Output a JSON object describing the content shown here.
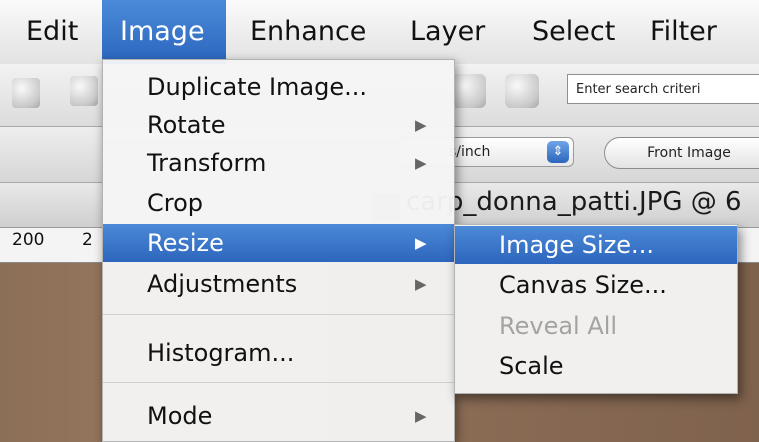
{
  "menubar": {
    "items": [
      {
        "label": "Edit"
      },
      {
        "label": "Image",
        "active": true
      },
      {
        "label": "Enhance"
      },
      {
        "label": "Layer"
      },
      {
        "label": "Select"
      },
      {
        "label": "Filter"
      }
    ]
  },
  "toolbar": {
    "search_placeholder": "Enter search criteri",
    "units_value": "s/inch",
    "front_image_label": "Front Image"
  },
  "document": {
    "title": "carp_donna_patti.JPG @ 6",
    "ruler_labels": [
      "200",
      "2"
    ]
  },
  "image_menu": {
    "items": [
      {
        "label": "Duplicate Image...",
        "has_submenu": false
      },
      {
        "label": "Rotate",
        "has_submenu": true
      },
      {
        "label": "Transform",
        "has_submenu": true
      },
      {
        "label": "Crop",
        "has_submenu": false
      },
      {
        "label": "Resize",
        "has_submenu": true,
        "highlighted": true
      },
      {
        "label": "Adjustments",
        "has_submenu": true
      },
      {
        "label": "Histogram...",
        "has_submenu": false
      },
      {
        "label": "Mode",
        "has_submenu": true
      }
    ],
    "submenu_arrow": "▶"
  },
  "resize_submenu": {
    "items": [
      {
        "label": "Image Size...",
        "highlighted": true,
        "enabled": true
      },
      {
        "label": "Canvas Size...",
        "enabled": true
      },
      {
        "label": "Reveal All",
        "enabled": false
      },
      {
        "label": "Scale",
        "enabled": true
      }
    ]
  },
  "colors": {
    "highlight": "#2d66bd",
    "menu_background": "#f5f5f5",
    "disabled_text": "#a3a3a3"
  }
}
